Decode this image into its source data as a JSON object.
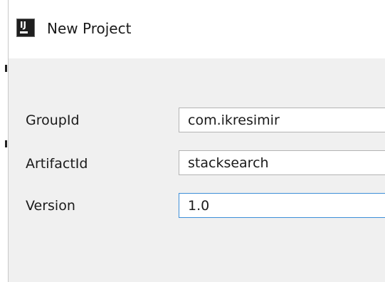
{
  "window": {
    "title": "New Project",
    "app_icon": {
      "name": "intellij-idea-icon",
      "text": "IJ"
    }
  },
  "form": {
    "fields": [
      {
        "label": "GroupId",
        "value": "com.ikresimir"
      },
      {
        "label": "ArtifactId",
        "value": "stacksearch"
      },
      {
        "label": "Version",
        "value": "1.0"
      }
    ]
  },
  "colors": {
    "background": "#f0f0f0",
    "focus_border": "#3d8fd8"
  }
}
